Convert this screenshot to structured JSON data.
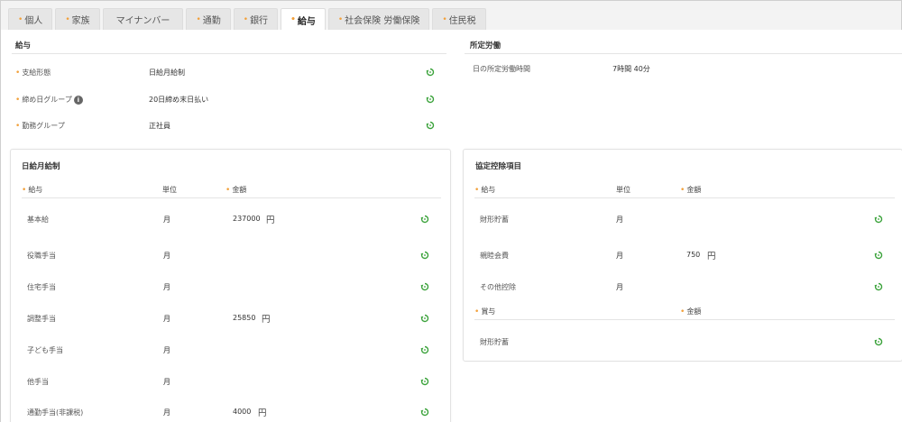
{
  "tabs": [
    {
      "label": "個人",
      "required": true
    },
    {
      "label": "家族",
      "required": true
    },
    {
      "label": "マイナンバー",
      "required": false
    },
    {
      "label": "通勤",
      "required": true
    },
    {
      "label": "銀行",
      "required": true
    },
    {
      "label": "給与",
      "required": true,
      "active": true
    },
    {
      "label": "社会保険 労働保険",
      "required": true
    },
    {
      "label": "住民税",
      "required": true
    }
  ],
  "salary": {
    "title": "給与",
    "rows": [
      {
        "label": "支給形態",
        "value": "日給月給制"
      },
      {
        "label": "締め日グループ",
        "value": "20日締め末日払い",
        "info": "i"
      },
      {
        "label": "勤務グループ",
        "value": "正社員"
      }
    ]
  },
  "work": {
    "title": "所定労働",
    "rows": [
      {
        "label": "日の所定労働時間",
        "value": "7時間 40分"
      }
    ]
  },
  "daily_monthly": {
    "title": "日給月給制",
    "headers": {
      "item": "給与",
      "unit": "単位",
      "amount": "金額"
    },
    "rows": [
      {
        "label": "基本給",
        "unit": "月",
        "amount": "237000",
        "currency": "円"
      },
      {
        "label": "役職手当",
        "unit": "月",
        "amount": "",
        "currency": ""
      },
      {
        "label": "住宅手当",
        "unit": "月",
        "amount": "",
        "currency": ""
      },
      {
        "label": "調整手当",
        "unit": "月",
        "amount": "25850",
        "currency": "円"
      },
      {
        "label": "子ども手当",
        "unit": "月",
        "amount": "",
        "currency": ""
      },
      {
        "label": "他手当",
        "unit": "月",
        "amount": "",
        "currency": ""
      },
      {
        "label": "通勤手当(非課税)",
        "unit": "月",
        "amount": "4000",
        "currency": "円"
      }
    ]
  },
  "deductions": {
    "title": "協定控除項目",
    "headers": {
      "item": "給与",
      "unit": "単位",
      "amount": "金額"
    },
    "rows": [
      {
        "label": "財形貯蓄",
        "unit": "月",
        "amount": "",
        "currency": ""
      },
      {
        "label": "親睦会費",
        "unit": "月",
        "amount": "750",
        "currency": "円"
      },
      {
        "label": "その他控除",
        "unit": "月",
        "amount": "",
        "currency": ""
      }
    ],
    "bonus_headers": {
      "item": "賞与",
      "amount": "金額"
    },
    "bonus_rows": [
      {
        "label": "財形貯蓄"
      }
    ]
  },
  "colors": {
    "required_dot": "#f2a03a",
    "reset_icon": "#3aa23a"
  }
}
